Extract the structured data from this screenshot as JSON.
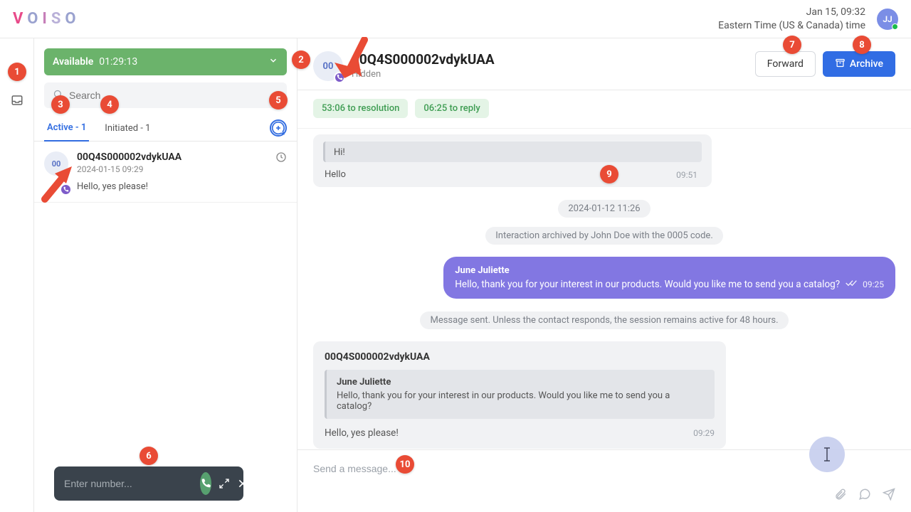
{
  "header": {
    "datetime": "Jan 15, 09:32",
    "tz": "Eastern Time (US & Canada) time",
    "avatar_initials": "JJ"
  },
  "status": {
    "label": "Available",
    "timer": "01:29:13"
  },
  "search": {
    "placeholder": "Search"
  },
  "tabs": {
    "active": "Active - 1",
    "initiated": "Initiated - 1"
  },
  "conversation": {
    "avatar": "00",
    "name": "00Q4S000002vdykUAA",
    "ts": "2024-01-15 09:29",
    "snippet": "Hello, yes please!"
  },
  "dialer": {
    "placeholder": "Enter number..."
  },
  "chat_header": {
    "avatar": "00",
    "title": "00Q4S000002vdykUAA",
    "subtitle": "Hidden",
    "forward": "Forward",
    "archive": "Archive"
  },
  "pills": {
    "resolution": "53:06 to resolution",
    "reply": "06:25 to reply"
  },
  "msg_in_top": {
    "quote_text": "Hi!",
    "text": "Hello",
    "time": "09:51"
  },
  "date_chip": "2024-01-12 11:26",
  "archived_chip": "Interaction archived by John Doe with the 0005 code.",
  "msg_out": {
    "name": "June Juliette",
    "text": "Hello, thank you for your interest in our products. Would you like me to send you a catalog?",
    "time": "09:25"
  },
  "sent_chip": "Message sent. Unless the contact responds, the session remains active for 48 hours.",
  "msg_in_big": {
    "from": "00Q4S000002vdykUAA",
    "quote_name": "June Juliette",
    "quote_text": "Hello, thank you for your interest in our products. Would you like me to send you a catalog?",
    "text": "Hello, yes please!",
    "time": "09:29"
  },
  "composer": {
    "placeholder": "Send a message..."
  },
  "annotations": [
    "1",
    "2",
    "3",
    "4",
    "5",
    "6",
    "7",
    "8",
    "9",
    "10"
  ]
}
